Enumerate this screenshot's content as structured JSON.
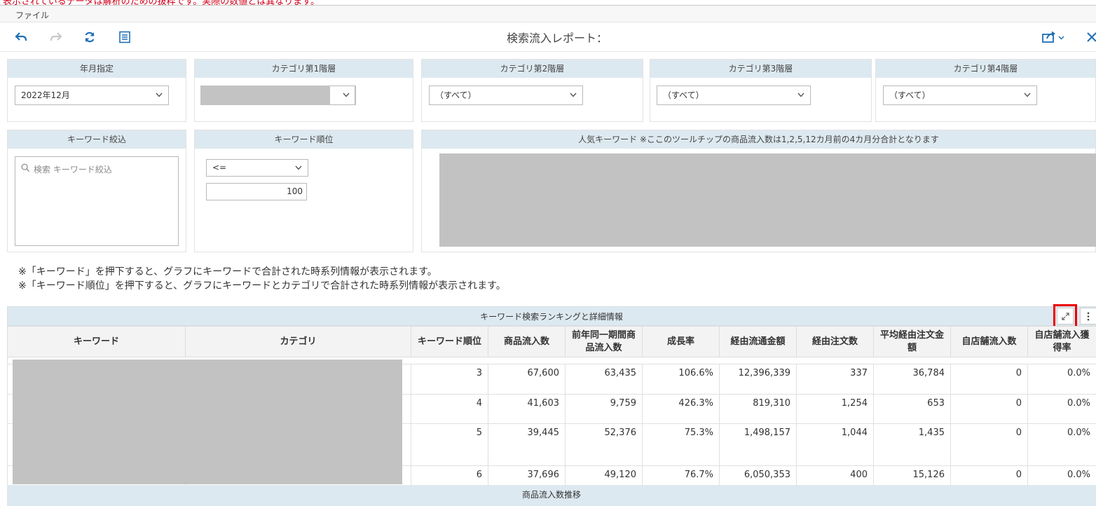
{
  "menu": {
    "file": "ファイル"
  },
  "toolbar": {
    "title": "検索流入レポート：",
    "icons": [
      "undo-icon",
      "redo-icon",
      "refresh-icon",
      "list-icon",
      "share-icon",
      "close-icon"
    ]
  },
  "filters": {
    "year_month": {
      "label": "年月指定",
      "value": "2022年12月"
    },
    "cat1": {
      "label": "カテゴリ第1階層",
      "value": ""
    },
    "cat2": {
      "label": "カテゴリ第2階層",
      "value": "（すべて）"
    },
    "cat3": {
      "label": "カテゴリ第3階層",
      "value": "（すべて）"
    },
    "cat4": {
      "label": "カテゴリ第4階層",
      "value": "（すべて）"
    }
  },
  "keyword_filter": {
    "label": "キーワード絞込",
    "placeholder": "検索 キーワード絞込"
  },
  "keyword_rank": {
    "label": "キーワード順位",
    "operator": "<=",
    "value": "100"
  },
  "popular": {
    "label": "人気キーワード ※ここのツールチップの商品流入数は1,2,5,12カ月前の4カ月分合計となります"
  },
  "notes": [
    "※「キーワード」を押下すると、グラフにキーワードで合計された時系列情報が表示されます。",
    "※「キーワード順位」を押下すると、グラフにキーワードとカテゴリで合計された時系列情報が表示されます。"
  ],
  "grid": {
    "title": "キーワード検索ランキングと詳細情報",
    "columns": [
      "キーワード",
      "カテゴリ",
      "キーワード順位",
      "商品流入数",
      "前年同一期間商品流入数",
      "成長率",
      "経由流通金額",
      "経由注文数",
      "平均経由注文金額",
      "自店舗流入数",
      "自店舗流入獲得率"
    ],
    "rows": [
      {
        "rank": "3",
        "inflow": "67,600",
        "prev": "63,435",
        "growth": "106.6%",
        "amount": "12,396,339",
        "orders": "337",
        "avg": "36,784",
        "own": "0",
        "rate": "0.0%"
      },
      {
        "rank": "4",
        "inflow": "41,603",
        "prev": "9,759",
        "growth": "426.3%",
        "amount": "819,310",
        "orders": "1,254",
        "avg": "653",
        "own": "0",
        "rate": "0.0%"
      },
      {
        "rank": "5",
        "inflow": "39,445",
        "prev": "52,376",
        "growth": "75.3%",
        "amount": "1,498,157",
        "orders": "1,044",
        "avg": "1,435",
        "own": "0",
        "rate": "0.0%"
      },
      {
        "rank": "6",
        "inflow": "37,696",
        "prev": "49,120",
        "growth": "76.7%",
        "amount": "6,050,353",
        "orders": "400",
        "avg": "15,126",
        "own": "0",
        "rate": "0.0%"
      }
    ]
  },
  "trend": {
    "title": "商品流入数推移"
  }
}
